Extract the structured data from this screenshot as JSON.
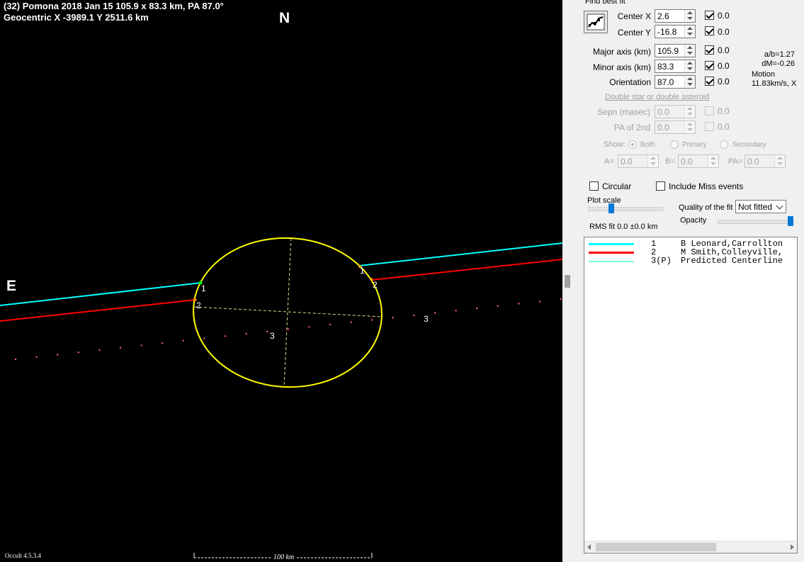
{
  "plot": {
    "title_line1": "(32) Pomona  2018 Jan 15  105.9 x 83.3 km, PA 87.0°",
    "title_line2": "Geocentric  X  -3989.1  Y 2511.6 km",
    "north_label": "N",
    "east_label": "E",
    "version_label": "Occult 4.5.3.4",
    "scale_label": "100 km",
    "chord_labels": [
      {
        "text": "1",
        "color": "#ffffff"
      },
      {
        "text": "2",
        "color": "#ffffff"
      },
      {
        "text": "1",
        "color": "#ffffff"
      },
      {
        "text": "2",
        "color": "#ffffff"
      },
      {
        "text": "3",
        "color": "#ffffff"
      },
      {
        "text": "3",
        "color": "#ffffff"
      }
    ],
    "colors": {
      "background": "#000000",
      "ellipse": "#ffff00",
      "axes": "#dddd88",
      "chord1": "#00ffff",
      "chord2": "#ff0000",
      "predicted_dots": "#ff6070"
    }
  },
  "panel": {
    "find_best_fit_label": "Find best fit",
    "fit_icon": "chart-fit-icon",
    "center_x": {
      "label": "Center X",
      "value": "2.6",
      "check_label": "0.0",
      "checked": true
    },
    "center_y": {
      "label": "Center Y",
      "value": "-16.8",
      "check_label": "0.0",
      "checked": true
    },
    "major_axis": {
      "label": "Major axis (km)",
      "value": "105.9",
      "check_label": "0.0",
      "checked": true
    },
    "minor_axis": {
      "label": "Minor axis (km)",
      "value": "83.3",
      "check_label": "0.0",
      "checked": true
    },
    "orientation": {
      "label": "Orientation",
      "value": "87.0",
      "check_label": "0.0",
      "checked": true
    },
    "ratio_ab": "a/b=1.27",
    "dm": "dM=-0.26",
    "motion_label": "Motion",
    "motion_value": "11.83km/s, X",
    "double_star_link": "Double star  or  double asteroid",
    "sepn": {
      "label": "Sepn (masec)",
      "value": "0.0",
      "check_label": "0.0"
    },
    "pa2nd": {
      "label": "PA of 2nd",
      "value": "0.0",
      "check_label": "0.0"
    },
    "show_label": "Show:",
    "show_options": [
      "Both",
      "Primary",
      "Secondary"
    ],
    "a_label": "A=",
    "a_value": "0.0",
    "b_label": "B=",
    "b_value": "0.0",
    "pa_label": "PA=",
    "pa_value": "0.0",
    "circular_label": "Circular",
    "include_miss_label": "Include Miss events",
    "plot_scale_label": "Plot scale",
    "quality_label": "Quality of the fit",
    "quality_value": "Not fitted",
    "opacity_label": "Opacity",
    "rms_fit": "RMS fit 0.0 ±0.0 km",
    "legend": [
      {
        "num": "1",
        "name": "B Leonard,Carrollton",
        "color": "#00ffff"
      },
      {
        "num": "2",
        "name": "M Smith,Colleyville,",
        "color": "#ff0000"
      },
      {
        "num": "3(P)",
        "name": "Predicted Centerline",
        "color": "#7fffd4"
      }
    ]
  }
}
